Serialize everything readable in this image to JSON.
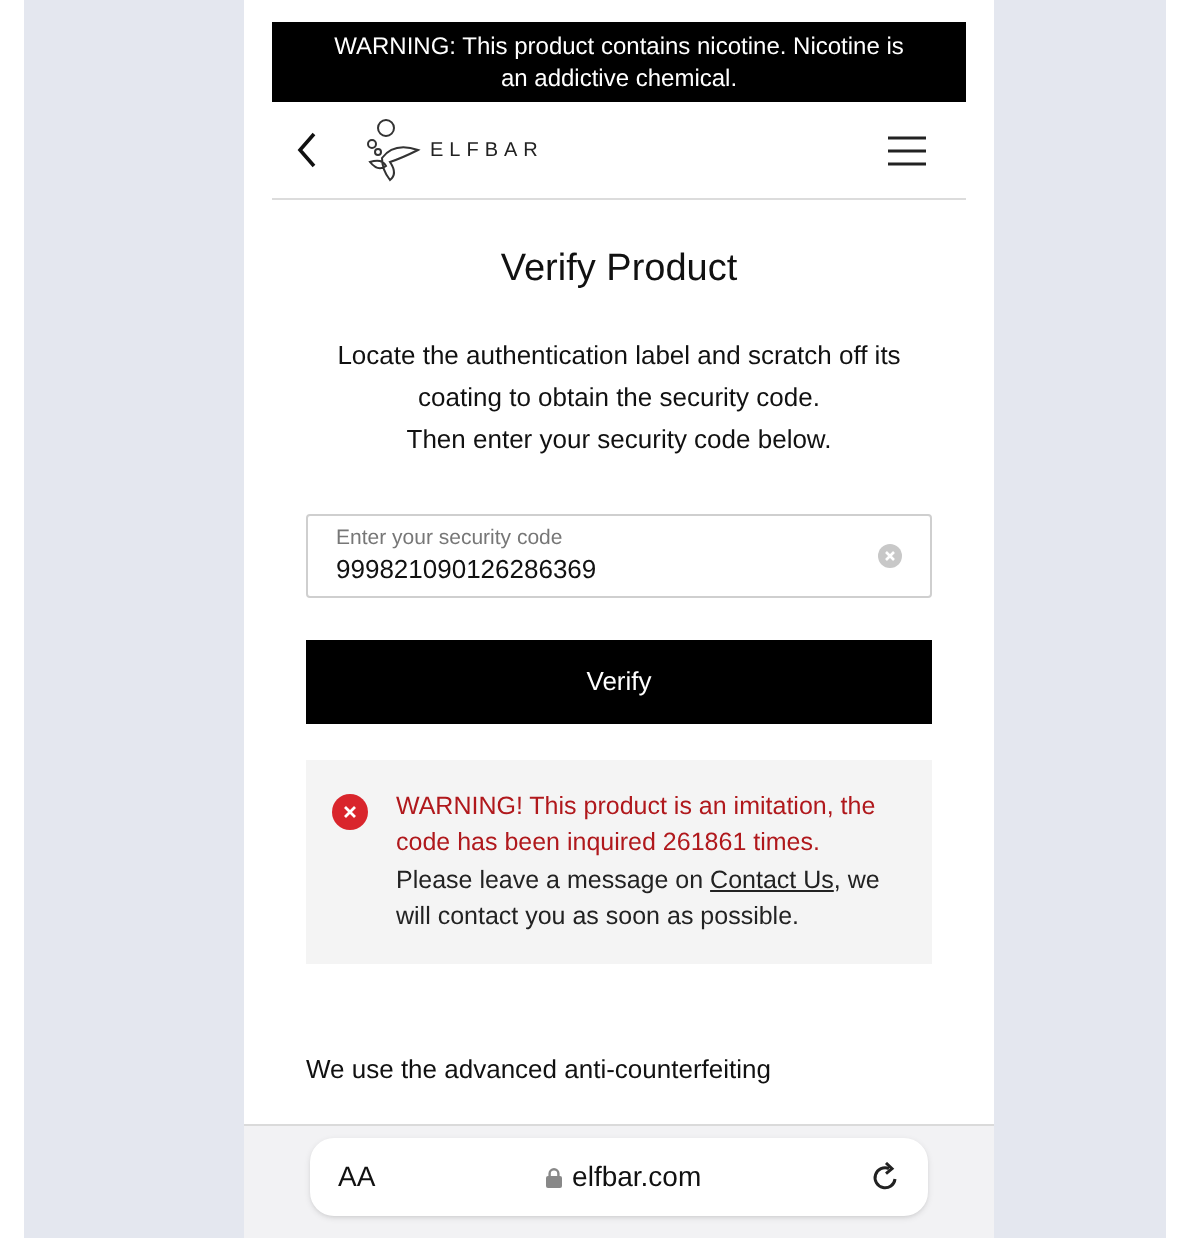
{
  "warning_banner": "WARNING: This product contains nicotine. Nicotine is an addictive chemical.",
  "header": {
    "logo_text": "ELFBAR"
  },
  "title": "Verify Product",
  "instructions": [
    "Locate the authentication label and scratch off its coating to obtain the security code.",
    "Then enter your security code below."
  ],
  "code_field": {
    "label": "Enter your security code",
    "value": "999821090126286369"
  },
  "verify_button": "Verify",
  "alert": {
    "warning": "WARNING! This product is an imitation, the code has been inquired 261861 times.",
    "message_before": "Please leave a message on",
    "link": "Contact Us",
    "message_after": ", we will contact you as soon as possible."
  },
  "footer_text": "We use the advanced anti-counterfeiting",
  "browser_bar": {
    "text_size_button": "AA",
    "url": "elfbar.com"
  }
}
